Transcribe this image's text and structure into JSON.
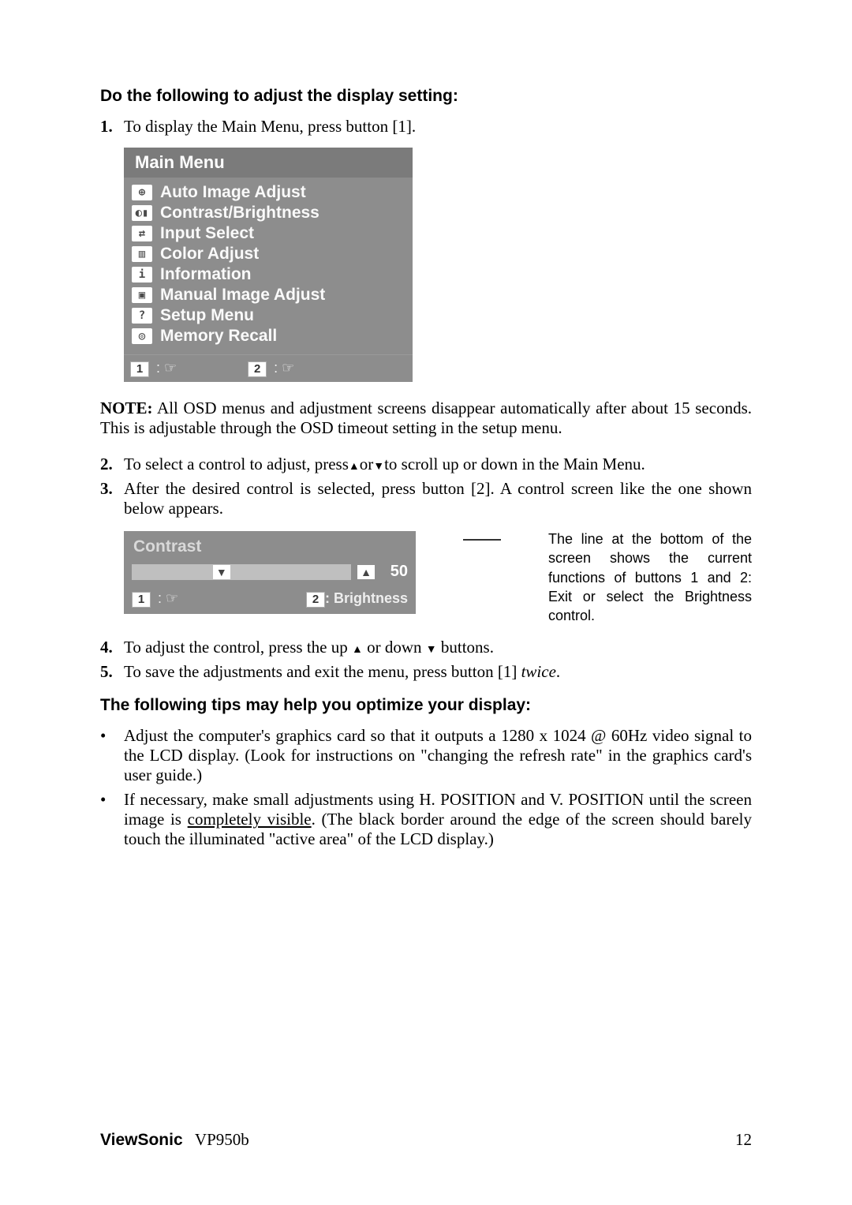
{
  "heading1": "Do the following to adjust the display setting:",
  "steps1": {
    "n1": "1.",
    "t1": "To display the Main Menu, press button [1]."
  },
  "osd": {
    "title": "Main Menu",
    "items": [
      {
        "icon": "⊕",
        "label": "Auto Image Adjust"
      },
      {
        "icon": "◐▮",
        "label": "Contrast/Brightness"
      },
      {
        "icon": "⇄",
        "label": "Input Select"
      },
      {
        "icon": "▥",
        "label": "Color Adjust"
      },
      {
        "icon": "i",
        "label": "Information"
      },
      {
        "icon": "▣",
        "label": "Manual Image Adjust"
      },
      {
        "icon": "?",
        "label": "Setup Menu"
      },
      {
        "icon": "◎",
        "label": "Memory Recall"
      }
    ],
    "key1": "1",
    "key2": "2"
  },
  "note_label": "NOTE:",
  "note_text": " All OSD menus and adjustment screens disappear automatically after about 15 seconds. This is adjustable through the OSD timeout setting in the setup menu.",
  "steps2": {
    "n2": "2.",
    "t2a": "To select a control to adjust, press",
    "t2b": "or",
    "t2c": "to scroll up or down in the Main Menu.",
    "n3": "3.",
    "t3": "After the desired control is selected, press button [2]. A control screen like the one shown below appears."
  },
  "contrast": {
    "title": "Contrast",
    "value": "50",
    "key1": "1",
    "key2": "2",
    "br_lbl": ": Brightness"
  },
  "annot": "The line at the bottom of the screen shows the current functions of buttons 1 and 2: Exit or select the Brightness control.",
  "steps3": {
    "n4": "4.",
    "t4a": "To adjust the control, press the up ",
    "t4b": " or down ",
    "t4c": " buttons.",
    "n5": "5.",
    "t5a": "To save the adjustments and exit the menu, press button [1] ",
    "t5b": "twice",
    "t5c": "."
  },
  "heading2": "The following tips may help you optimize your display:",
  "tips": {
    "b1": "•",
    "t1": "Adjust the computer's graphics card so that it outputs a 1280 x 1024 @ 60Hz video signal to the LCD display. (Look for instructions on \"changing the refresh rate\" in the graphics card's user guide.)",
    "b2": "•",
    "t2a": "If necessary, make small adjustments using H. POSITION and V. POSITION until the screen image is ",
    "t2u": "completely visible",
    "t2b": ". (The black border around the edge of the screen should barely touch the illuminated \"active area\" of the LCD display.)"
  },
  "footer": {
    "brand": "ViewSonic",
    "model": "VP950b",
    "page": "12"
  }
}
